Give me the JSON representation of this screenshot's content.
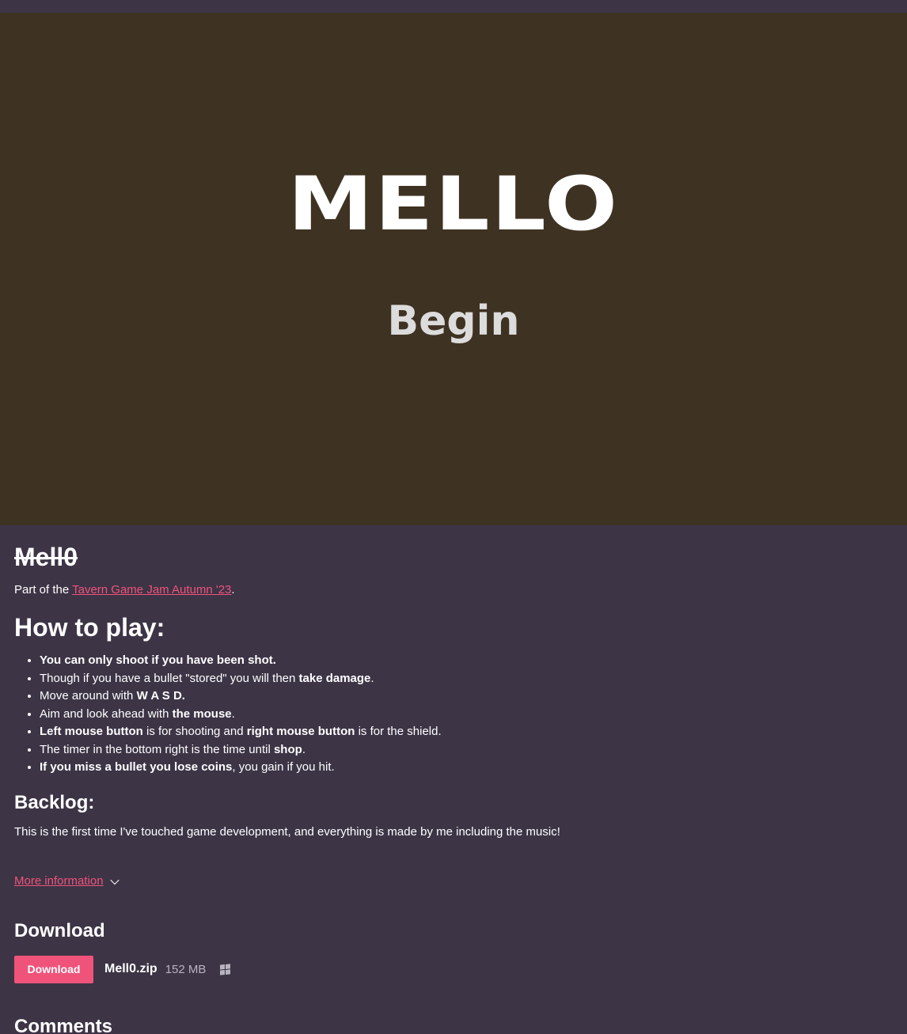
{
  "game": {
    "logo": "MELLO",
    "begin": "Begin"
  },
  "page": {
    "title": "Mell0",
    "jam_prefix": "Part of the ",
    "jam_link": "Tavern Game Jam Autumn '23",
    "jam_suffix": "."
  },
  "howto": {
    "heading": "How to play:",
    "rules": [
      [
        {
          "t": "You can only shoot if you have been shot.",
          "b": true
        }
      ],
      [
        {
          "t": "Though if you have a bullet \"stored\" you will then "
        },
        {
          "t": "take damage",
          "b": true
        },
        {
          "t": "."
        }
      ],
      [
        {
          "t": "Move around with "
        },
        {
          "t": "W A S D.",
          "b": true
        }
      ],
      [
        {
          "t": "Aim and look ahead with "
        },
        {
          "t": "the mouse",
          "b": true
        },
        {
          "t": "."
        }
      ],
      [
        {
          "t": "Left mouse button",
          "b": true
        },
        {
          "t": " is for shooting and "
        },
        {
          "t": "right mouse button",
          "b": true
        },
        {
          "t": " is for the shield."
        }
      ],
      [
        {
          "t": "The timer in the bottom right is the time until "
        },
        {
          "t": "shop",
          "b": true
        },
        {
          "t": "."
        }
      ],
      [
        {
          "t": "If you miss a bullet you lose coins",
          "b": true
        },
        {
          "t": ", you gain if you hit."
        }
      ]
    ]
  },
  "backlog": {
    "heading": "Backlog:",
    "text": "This is the first time I've touched game development, and everything is made by me including the music!"
  },
  "more_info": {
    "label": "More information",
    "icon": "chevron-down-icon"
  },
  "download": {
    "heading": "Download",
    "button_label": "Download",
    "file_name": "Mell0.zip",
    "file_size": "152 MB",
    "platform_icon": "windows-icon"
  },
  "comments": {
    "heading": "Comments"
  },
  "colors": {
    "page_bg": "#3d3446",
    "game_bg": "#3e3222",
    "accent": "#f0537a"
  }
}
